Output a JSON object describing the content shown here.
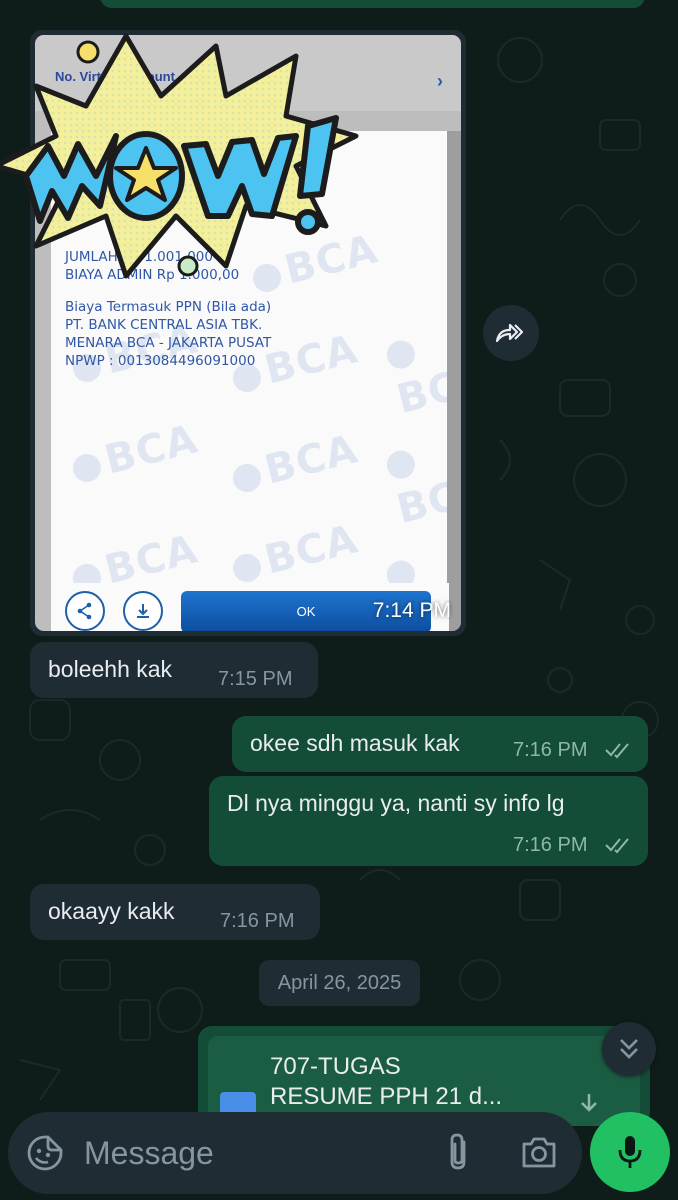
{
  "conversation": {
    "image_message": {
      "time": "7:14 PM",
      "receipt": {
        "account_label": "No. Virtual Account",
        "lines": [
          "JUMLAH Rp 1.001,000",
          "BIAYA ADMIN Rp 1.000,00",
          "Biaya Termasuk PPN (Bila ada)",
          "PT. BANK CENTRAL ASIA TBK.",
          "MENARA BCA - JAKARTA PUSAT",
          "NPWP : 0013084496091000"
        ],
        "watermark": "BCA",
        "ok_label": "OK"
      },
      "sticker_text": "WOW!"
    },
    "messages": [
      {
        "direction": "in",
        "text": "boleehh kak",
        "time": "7:15 PM"
      },
      {
        "direction": "out",
        "text": "okee sdh masuk kak",
        "time": "7:16 PM",
        "status": "read"
      },
      {
        "direction": "out",
        "text": "Dl nya minggu ya, nanti sy info lg",
        "time": "7:16 PM",
        "status": "read"
      },
      {
        "direction": "in",
        "text": "okaayy kakk",
        "time": "7:16 PM"
      }
    ],
    "date_separator": "April 26, 2025",
    "file_message": {
      "file_name_line1": "707-TUGAS",
      "file_name_line2": "RESUME PPH 21 d..."
    }
  },
  "composer": {
    "placeholder": "Message"
  },
  "icons": {
    "emoji": "sticker-icon",
    "attach": "paperclip-icon",
    "camera": "camera-icon",
    "mic": "mic-icon",
    "forward": "forward-icon",
    "scroll": "double-chevron-down-icon",
    "read_ticks": "double-check-icon"
  },
  "colors": {
    "background": "#0f1d1a",
    "incoming_bubble": "#1f2c33",
    "outgoing_bubble": "#144d37",
    "accent_green": "#21c063",
    "muted_text": "#8696a0"
  }
}
